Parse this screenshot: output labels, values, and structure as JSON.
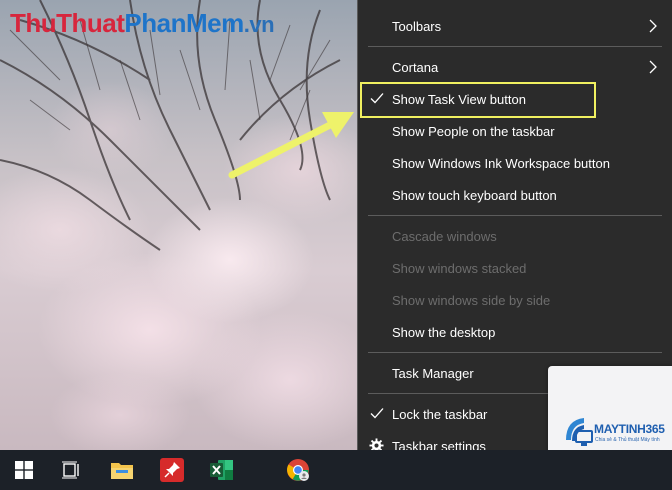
{
  "watermark": {
    "part1": "ThuThuat",
    "part2": "PhanMem",
    "part3": ".vn"
  },
  "menu": {
    "toolbars": "Toolbars",
    "cortana": "Cortana",
    "show_task_view": "Show Task View button",
    "show_people": "Show People on the taskbar",
    "show_ink": "Show Windows Ink Workspace button",
    "show_touch_keyboard": "Show touch keyboard button",
    "cascade": "Cascade windows",
    "stacked": "Show windows stacked",
    "side_by_side": "Show windows side by side",
    "show_desktop": "Show the desktop",
    "task_manager": "Task Manager",
    "lock_taskbar": "Lock the taskbar",
    "taskbar_settings": "Taskbar settings"
  },
  "logo": {
    "brand": "MAYTINH365",
    "tagline": "Chia sẻ & Thủ thuật Máy tính"
  },
  "colors": {
    "highlight": "#f0f060",
    "menu_bg": "#2b2b2b",
    "disabled_text": "#6d6d6d",
    "taskbar_bg": "#1c2128"
  },
  "icons": {
    "checked": "check-icon",
    "submenu": "chevron-right-icon",
    "settings": "gear-icon"
  }
}
